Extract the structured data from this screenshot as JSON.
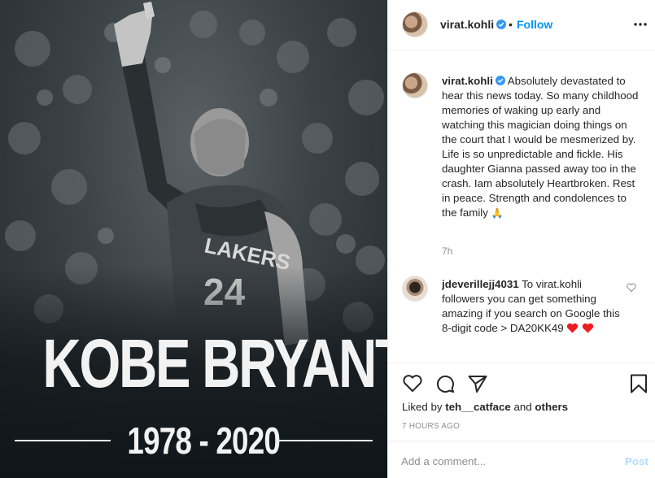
{
  "poster": {
    "title": "KOBE BRYANT",
    "years": "1978 - 2020",
    "jersey_text": "LAKERS",
    "jersey_number": "24"
  },
  "header": {
    "username": "virat.kohli",
    "separator": "•",
    "follow_label": "Follow"
  },
  "caption": {
    "username": "virat.kohli",
    "text": "Absolutely devastated to hear this news today. So many childhood memories of waking up early and watching this magician doing things on the court that I would be mesmerized by. Life is so unpredictable and fickle. His daughter Gianna passed away too in the crash. Iam absolutely Heartbroken. Rest in peace. Strength and condolences to the family",
    "emoji": "🙏",
    "time": "7h"
  },
  "comment": {
    "username": "jdeverillejj4031",
    "text": "To virat.kohli followers you can get something amazing if you search on Google this 8-digit code > DA20KK49"
  },
  "likes": {
    "prefix": "Liked by",
    "user": "teh__catface",
    "conj": "and",
    "others": "others"
  },
  "post_time": "7 HOURS AGO",
  "add_comment": {
    "placeholder": "Add a comment...",
    "post_label": "Post"
  },
  "colors": {
    "accent": "#0095f6",
    "post_disabled": "#b3dbff",
    "heart_red": "#ed1c24",
    "muted": "#8e8e8e"
  },
  "icons": [
    "verified-badge-icon",
    "more-options-icon",
    "heart-icon",
    "comment-icon",
    "share-icon",
    "save-icon",
    "small-heart-icon",
    "red-heart-icon"
  ]
}
